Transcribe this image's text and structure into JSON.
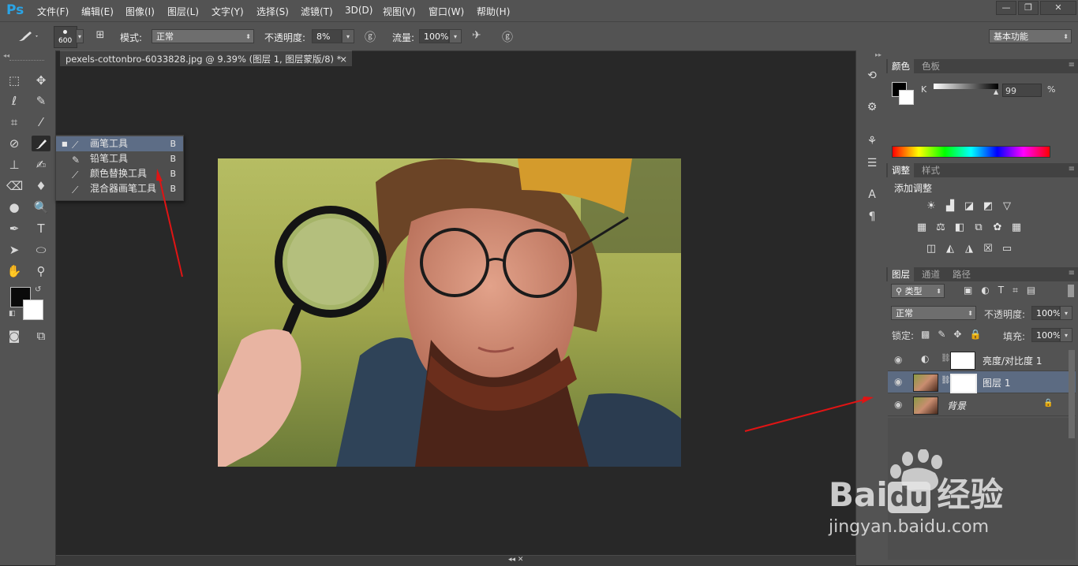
{
  "app": {
    "logo": "Ps"
  },
  "menu": [
    "文件(F)",
    "编辑(E)",
    "图像(I)",
    "图层(L)",
    "文字(Y)",
    "选择(S)",
    "滤镜(T)",
    "3D(D)",
    "视图(V)",
    "窗口(W)",
    "帮助(H)"
  ],
  "window_controls": [
    "—",
    "❐",
    "✕"
  ],
  "options": {
    "brush_size": "600",
    "mode_label": "模式:",
    "mode_value": "正常",
    "opacity_label": "不透明度:",
    "opacity_value": "8%",
    "flow_label": "流量:",
    "flow_value": "100%",
    "workspace": "基本功能"
  },
  "document": {
    "tab_title": "pexels-cottonbro-6033828.jpg @ 9.39% (图层 1, 图层蒙版/8) *",
    "tab_close": "×"
  },
  "flyout": [
    {
      "label": "画笔工具",
      "key": "B",
      "icon": "brush-icon",
      "selected": true
    },
    {
      "label": "铅笔工具",
      "key": "B",
      "icon": "pencil-icon",
      "selected": false
    },
    {
      "label": "颜色替换工具",
      "key": "B",
      "icon": "color-replace-icon",
      "selected": false
    },
    {
      "label": "混合器画笔工具",
      "key": "B",
      "icon": "mixer-brush-icon",
      "selected": false
    }
  ],
  "color_panel": {
    "tabs": [
      "颜色",
      "色板"
    ],
    "channel": "K",
    "value": "99",
    "unit": "%",
    "slider_value": 99
  },
  "adjust_panel": {
    "tabs": [
      "调整",
      "样式"
    ],
    "title": "添加调整"
  },
  "layers_panel": {
    "tabs": [
      "图层",
      "通道",
      "路径"
    ],
    "filter_label": "类型",
    "blend_mode": "正常",
    "opacity_label": "不透明度:",
    "opacity_value": "100%",
    "lock_label": "锁定:",
    "fill_label": "填充:",
    "fill_value": "100%",
    "layers": [
      {
        "name": "亮度/对比度 1",
        "type": "adjustment",
        "selected": false
      },
      {
        "name": "图层 1",
        "type": "masked",
        "selected": true
      },
      {
        "name": "背景",
        "type": "background",
        "selected": false
      }
    ]
  },
  "colors": {
    "accent_selection": "#5c6b82",
    "arrow": "#e01414",
    "ps_blue": "#2aa4e6"
  },
  "watermark": {
    "brand": "Bai",
    "brand2": "du",
    "text": "经验",
    "url": "jingyan.baidu.com"
  }
}
